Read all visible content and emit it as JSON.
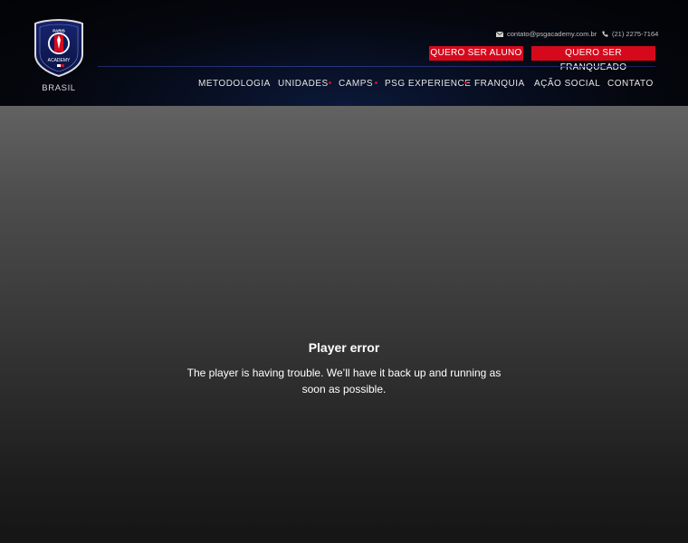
{
  "brand": {
    "logo_text_top": "PARIS",
    "logo_text_bottom": "ACADEMY",
    "subtitle": "BRASIL",
    "colors": {
      "navy": "#0f1a5c",
      "red": "#d6091c"
    }
  },
  "contact": {
    "email": "contato@psgacademy.com.br",
    "email_icon": "envelope-icon",
    "phone": "(21) 2275-7164",
    "phone_icon": "phone-icon"
  },
  "buttons": {
    "aluno": "QUERO SER ALUNO",
    "franqueado": "QUERO SER FRANQUEADO"
  },
  "nav": {
    "items": [
      "METODOLOGIA",
      "UNIDADES",
      "CAMPS",
      "PSG EXPERIENCE",
      "FRANQUIA",
      "AÇÃO SOCIAL",
      "CONTATO"
    ]
  },
  "player": {
    "error_title": "Player error",
    "error_message": "The player is having trouble. We’ll have it back up and running as soon as possible."
  }
}
